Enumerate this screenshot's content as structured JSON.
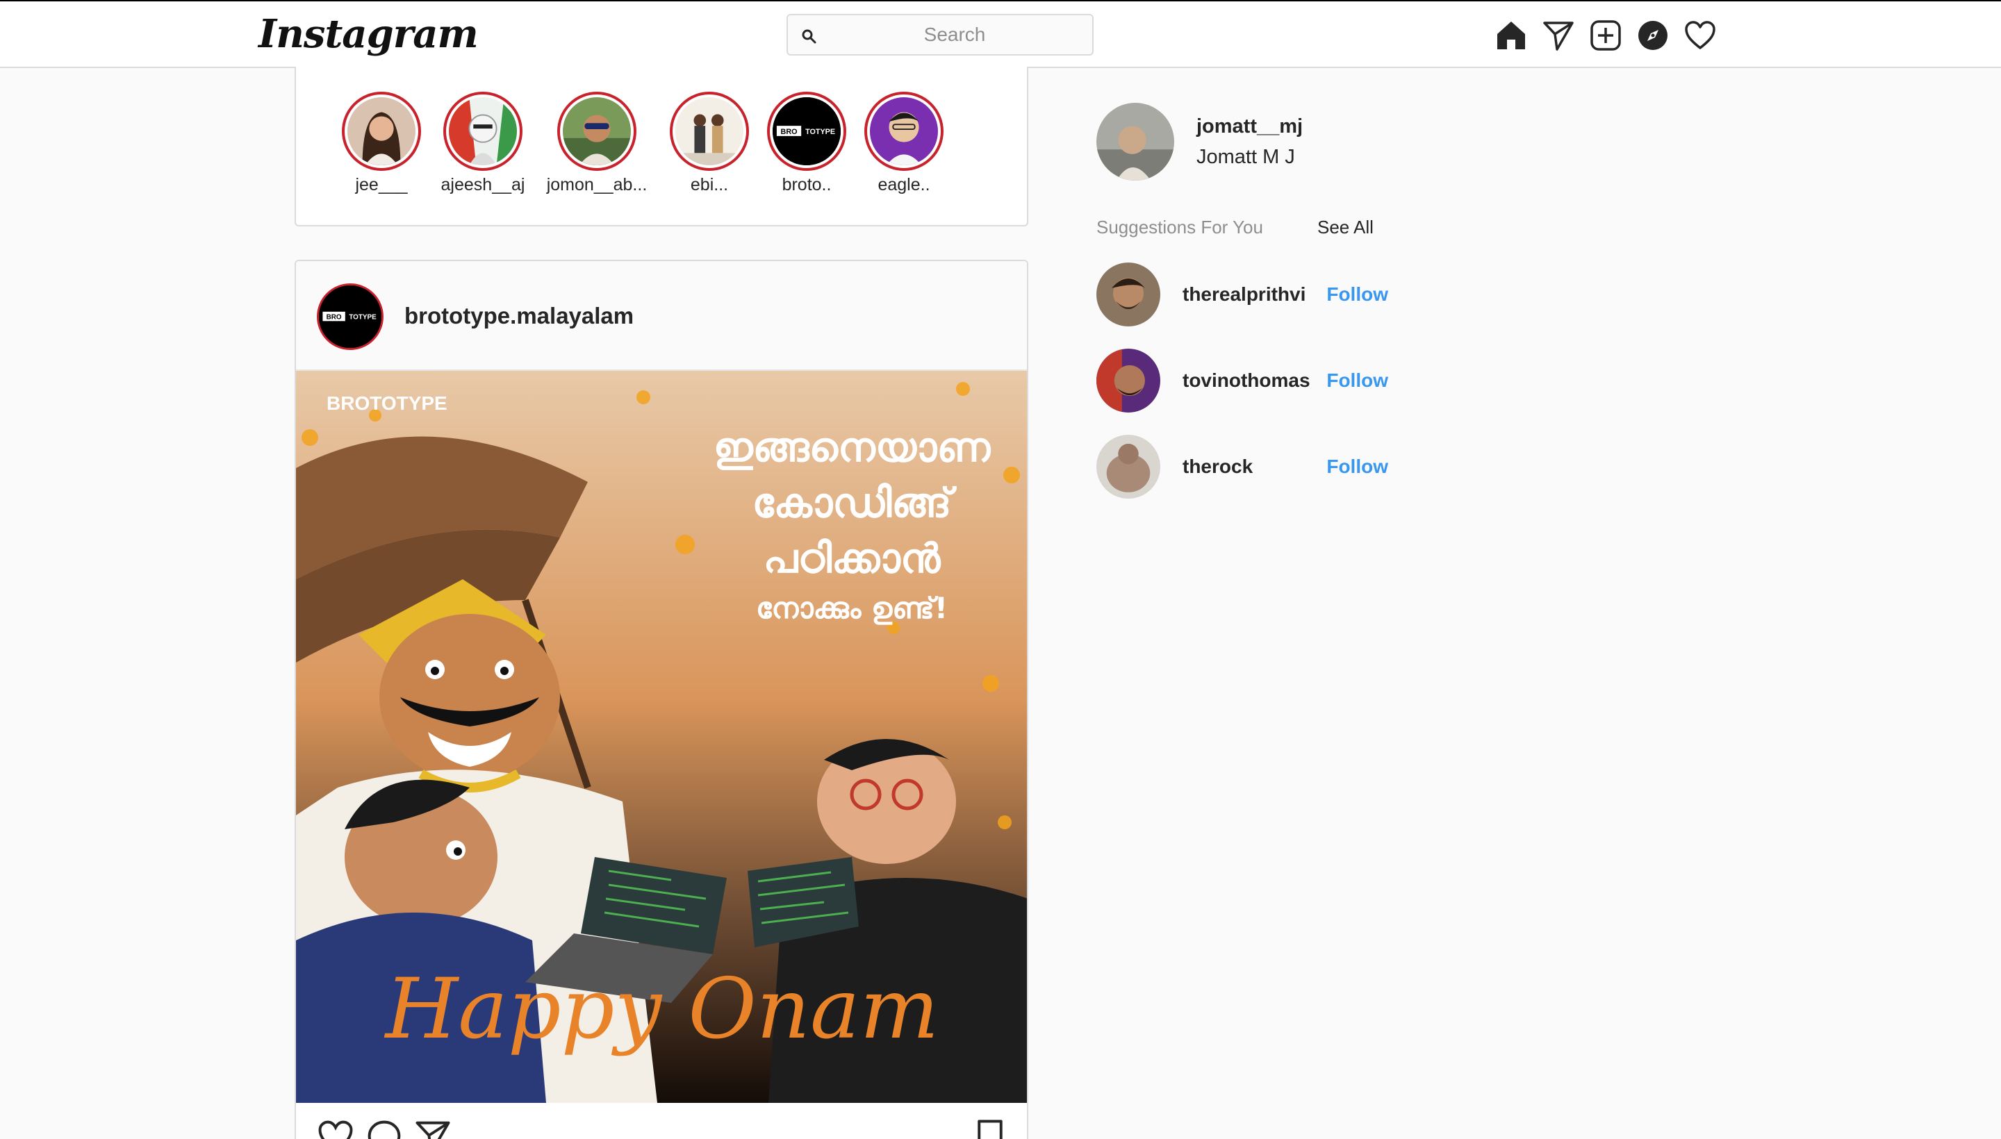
{
  "app": {
    "logo_text": "Instagram"
  },
  "search": {
    "placeholder": "Search"
  },
  "nav": {
    "icons": [
      "home-icon",
      "direct-message-icon",
      "new-post-icon",
      "explore-icon",
      "activity-heart-icon"
    ]
  },
  "stories": [
    {
      "username": "jee___"
    },
    {
      "username": "ajeesh__aj"
    },
    {
      "username": "jomon__ab..."
    },
    {
      "username": "ebi..."
    },
    {
      "username": "broto.."
    },
    {
      "username": "eagle.."
    }
  ],
  "post": {
    "username": "brototype.malayalam",
    "avatar_logo": "BROTOTYPE",
    "image": {
      "brand": "BROTOTYPE",
      "malayalam_lines": [
        "ഇങ്ങനെയാണ",
        "കോഡിങ്ങ്",
        "പഠിക്കാൻ",
        "നോക്കും ഉണ്ട്!"
      ],
      "greeting": "Happy Onam"
    },
    "actions": [
      "like-heart-icon",
      "comment-icon",
      "share-icon",
      "save-bookmark-icon"
    ]
  },
  "sidebar": {
    "me": {
      "username": "jomatt__mj",
      "full_name": "Jomatt M J"
    },
    "suggestions_title": "Suggestions For You",
    "see_all": "See All",
    "suggestions": [
      {
        "username": "therealprithvi",
        "action": "Follow"
      },
      {
        "username": "tovinothomas",
        "action": "Follow"
      },
      {
        "username": "therock",
        "action": "Follow"
      }
    ]
  },
  "colors": {
    "accent_blue": "#3897f0",
    "story_ring": "#c8232c",
    "border": "#dbdbdb",
    "background": "#fafafa"
  }
}
